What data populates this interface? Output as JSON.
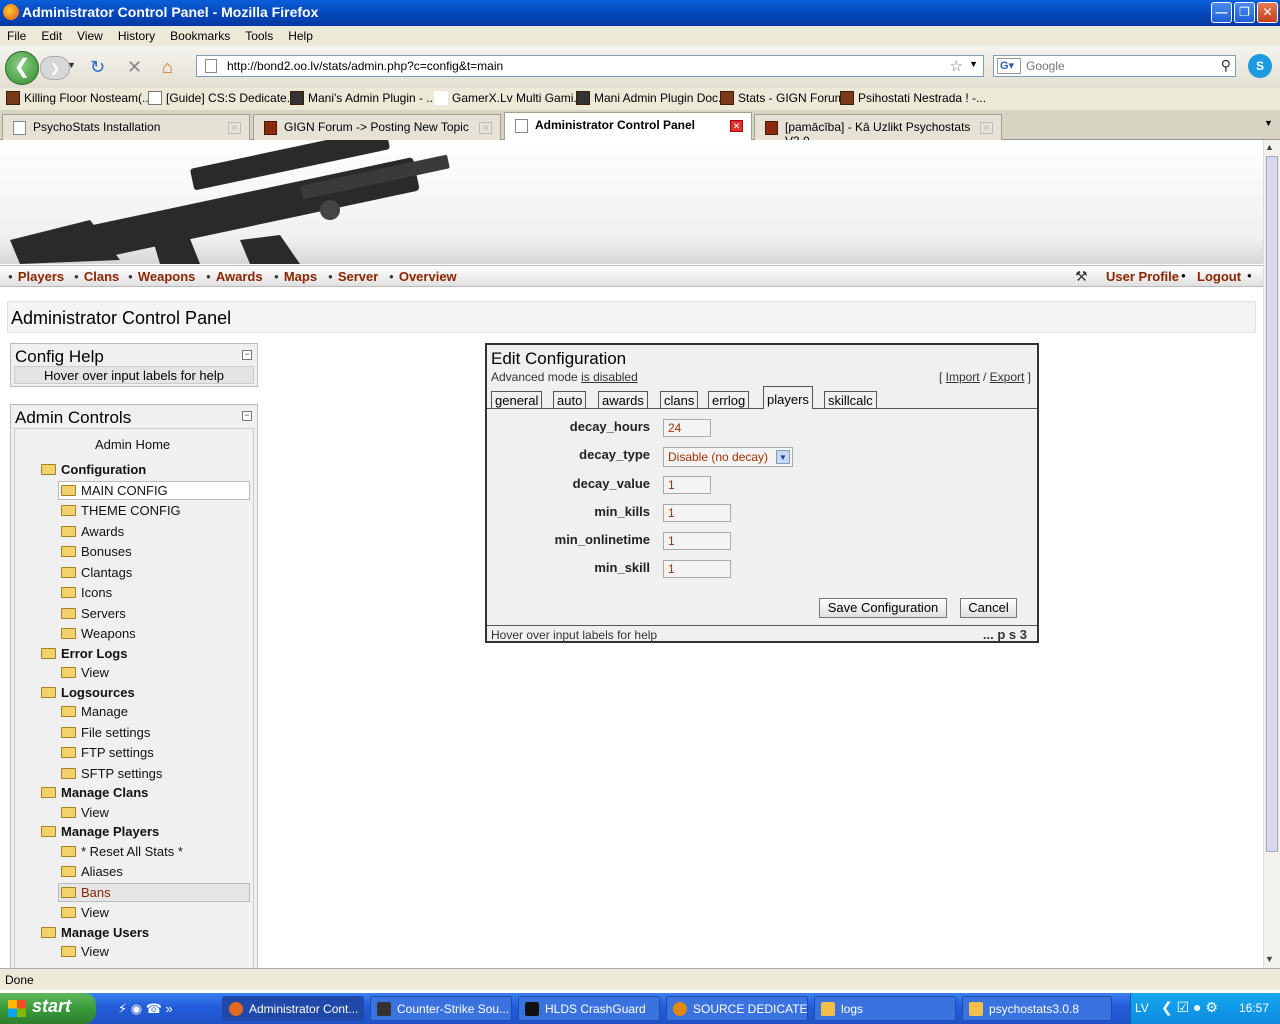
{
  "window": {
    "title": "Administrator Control Panel - Mozilla Firefox"
  },
  "menubar": [
    "File",
    "Edit",
    "View",
    "History",
    "Bookmarks",
    "Tools",
    "Help"
  ],
  "toolbar": {
    "url": "http://bond2.oo.lv/stats/admin.php?c=config&t=main",
    "search_placeholder": "Google"
  },
  "bookmarks": [
    "Killing Floor Nosteam(...",
    "[Guide] CS:S Dedicate...",
    "Mani's Admin Plugin - ...",
    "GamerX.Lv Multi Gami...",
    "Mani Admin Plugin Doc...",
    "Stats - GIGN Forum",
    "Psihostati Nestrada ! -..."
  ],
  "tabs": [
    {
      "label": "PsychoStats Installation"
    },
    {
      "label": "GIGN Forum -> Posting New Topic"
    },
    {
      "label": "Administrator Control Panel"
    },
    {
      "label": "[pamācība] - Kā Uzlikt Psychostats V3.0..."
    }
  ],
  "nav": {
    "left": [
      "Players",
      "Clans",
      "Weapons",
      "Awards",
      "Maps",
      "Server",
      "Overview"
    ],
    "user_profile": "User Profile",
    "logout": "Logout"
  },
  "page_title": "Administrator Control Panel",
  "config_help": {
    "title": "Config Help",
    "text": "Hover over input labels for help"
  },
  "admin_controls": {
    "title": "Admin Controls",
    "home": "Admin Home",
    "groups": [
      {
        "label": "Configuration",
        "items": [
          "MAIN CONFIG",
          "THEME CONFIG",
          "Awards",
          "Bonuses",
          "Clantags",
          "Icons",
          "Servers",
          "Weapons"
        ]
      },
      {
        "label": "Error Logs",
        "items": [
          "View"
        ]
      },
      {
        "label": "Logsources",
        "items": [
          "Manage",
          "File settings",
          "FTP settings",
          "SFTP settings"
        ]
      },
      {
        "label": "Manage Clans",
        "items": [
          "View"
        ]
      },
      {
        "label": "Manage Players",
        "items": [
          "* Reset All Stats *",
          "Aliases",
          "Bans",
          "View"
        ]
      },
      {
        "label": "Manage Users",
        "items": [
          "View"
        ]
      }
    ]
  },
  "edit": {
    "title": "Edit Configuration",
    "advanced_prefix": "Advanced mode ",
    "advanced_link": "is disabled",
    "import": "Import",
    "export": "Export",
    "tabs": [
      "general",
      "auto",
      "awards",
      "clans",
      "errlog",
      "players",
      "skillcalc"
    ],
    "fields": [
      {
        "label": "decay_hours",
        "value": "24"
      },
      {
        "label": "decay_type",
        "value": "Disable (no decay)"
      },
      {
        "label": "decay_value",
        "value": "1"
      },
      {
        "label": "min_kills",
        "value": "1"
      },
      {
        "label": "min_onlinetime",
        "value": "1"
      },
      {
        "label": "min_skill",
        "value": "1"
      }
    ],
    "save": "Save Configuration",
    "cancel": "Cancel",
    "footer_help": "Hover over input labels for help",
    "footer_brand": "... p s 3"
  },
  "statusbar": "Done",
  "taskbar": {
    "start": "start",
    "tasks": [
      "Administrator Cont...",
      "Counter-Strike Sou...",
      "HLDS CrashGuard",
      "SOURCE DEDICATE...",
      "logs",
      "psychostats3.0.8"
    ],
    "lang": "LV",
    "time": "16:57"
  }
}
